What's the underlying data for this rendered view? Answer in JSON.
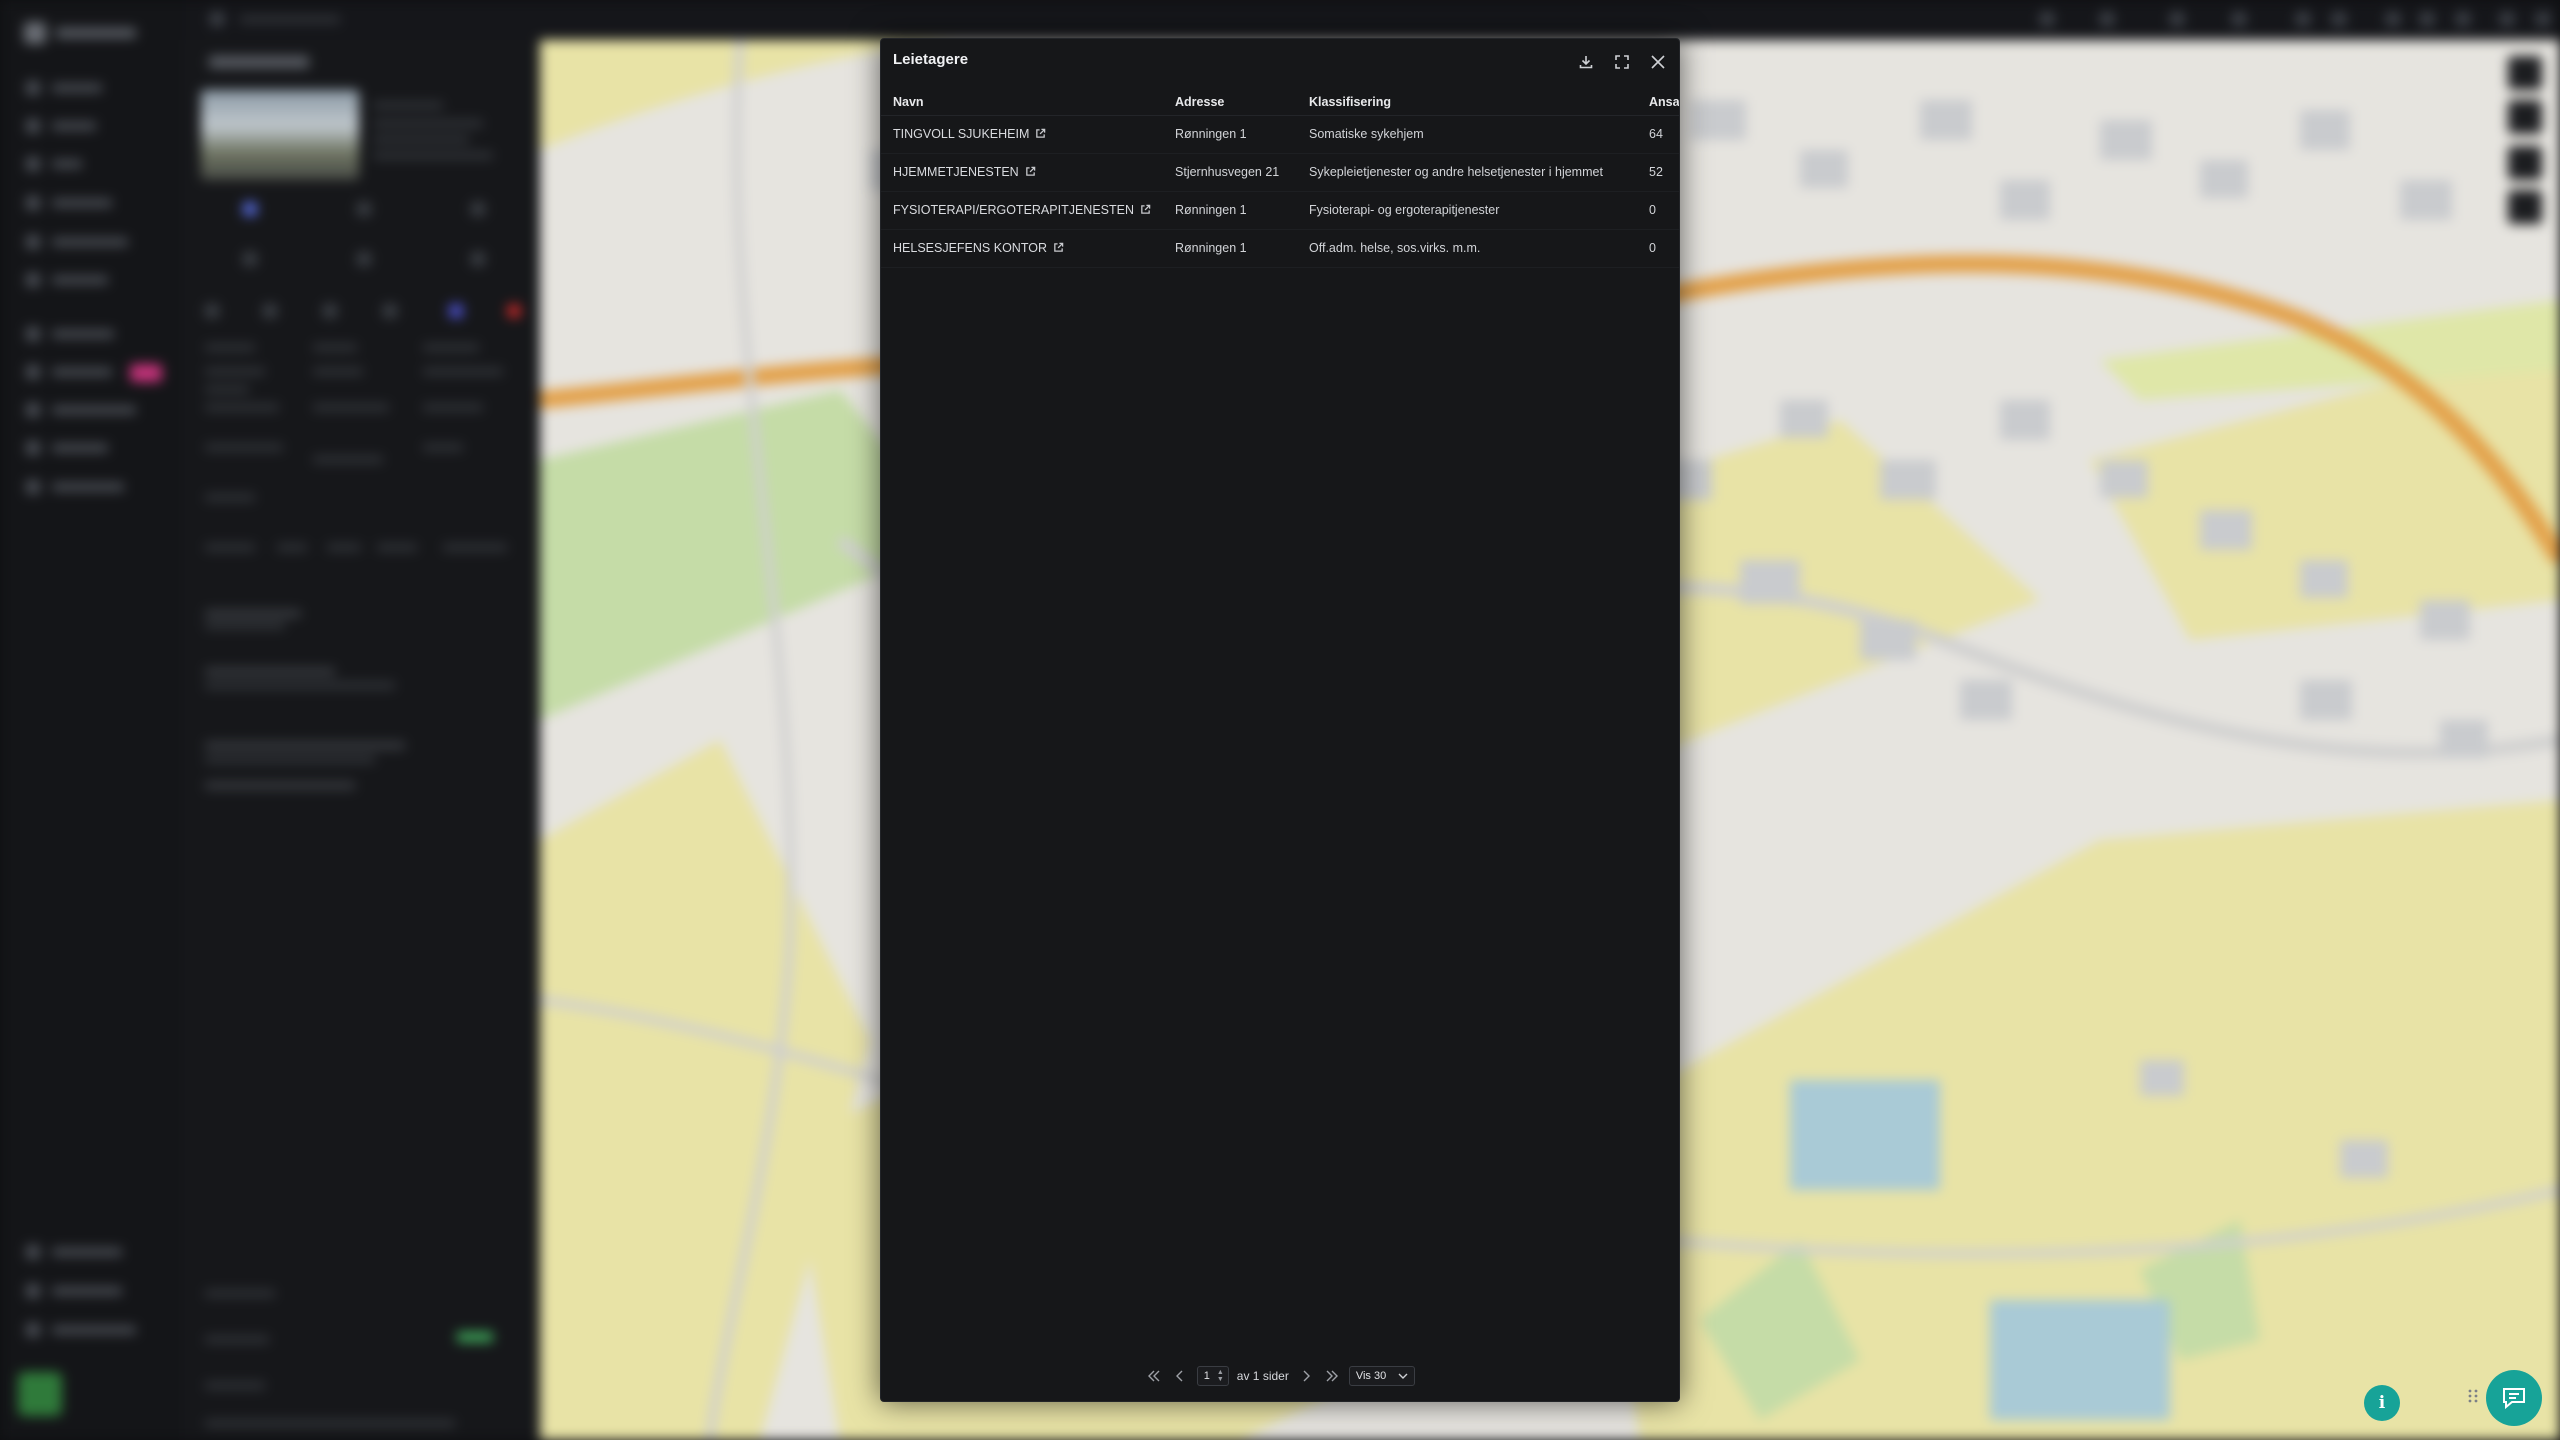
{
  "modal": {
    "title": "Leietagere",
    "columns": [
      "Navn",
      "Adresse",
      "Klassifisering",
      "Ansatt"
    ],
    "rows": [
      {
        "name": "TINGVOLL SJUKEHEIM",
        "address": "Rønningen 1",
        "classification": "Somatiske sykehjem",
        "employees": "64"
      },
      {
        "name": "HJEMMETJENESTEN",
        "address": "Stjernhusvegen 21",
        "classification": "Sykepleietjenester og andre helsetjenester i hjemmet",
        "employees": "52"
      },
      {
        "name": "FYSIOTERAPI/ERGOTERAPITJENESTEN",
        "address": "Rønningen 1",
        "classification": "Fysioterapi- og ergoterapitjenester",
        "employees": "0"
      },
      {
        "name": "HELSESJEFENS KONTOR",
        "address": "Rønningen 1",
        "classification": "Off.adm. helse, sos.virks. m.m.",
        "employees": "0"
      }
    ],
    "icons": {
      "download": "download-icon",
      "expand": "expand-icon",
      "close": "close-icon",
      "external": "external-link-icon"
    }
  },
  "pager": {
    "page": "1",
    "of_label": "av 1 sider",
    "per_page": "Vis 30"
  },
  "fabs": {
    "info": "i"
  },
  "colors": {
    "accent": "#17a398",
    "modal_bg": "#161719",
    "map_yellow": "#e8e3a6",
    "map_road": "#e3a14a",
    "map_water": "#a9d4de",
    "map_green": "#c5dca7"
  }
}
